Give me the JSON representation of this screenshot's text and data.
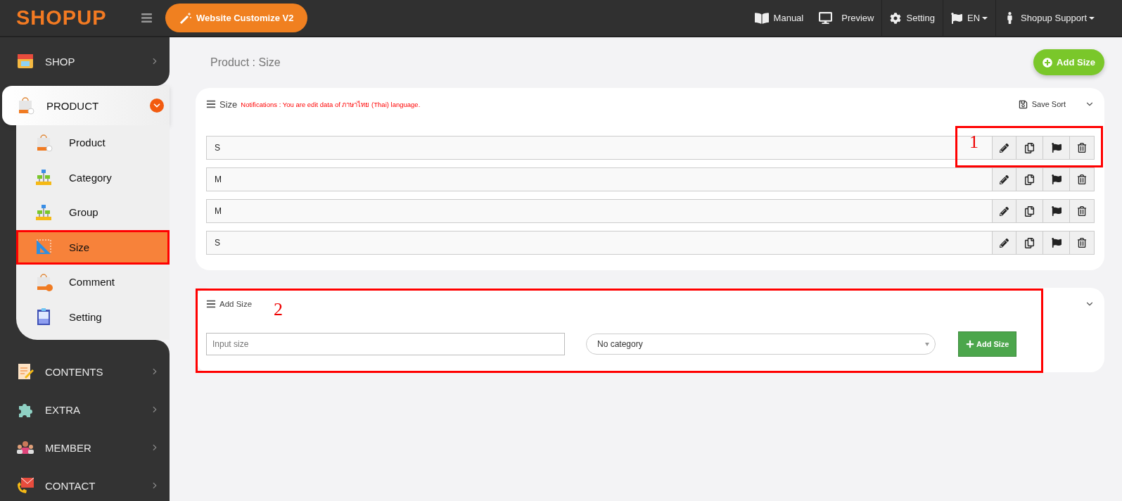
{
  "brand": {
    "logo": "SHOPUP"
  },
  "topbar": {
    "customize_button": "Website Customize V2",
    "links": [
      {
        "kind": "manual",
        "label": "Manual",
        "dropdown": false
      },
      {
        "kind": "preview",
        "label": "Preview",
        "dropdown": false
      },
      {
        "kind": "setting",
        "label": "Setting",
        "dropdown": false
      },
      {
        "kind": "language",
        "label": "EN",
        "dropdown": true
      },
      {
        "kind": "user",
        "label": "Shopup Support",
        "dropdown": true
      }
    ]
  },
  "sidebar": {
    "items": [
      {
        "kind": "shop",
        "label": "SHOP",
        "expanded": false
      },
      {
        "kind": "product",
        "label": "PRODUCT",
        "expanded": true,
        "children": [
          {
            "kind": "product",
            "label": "Product",
            "selected": false,
            "annotated": false
          },
          {
            "kind": "category",
            "label": "Category",
            "selected": false,
            "annotated": false
          },
          {
            "kind": "group",
            "label": "Group",
            "selected": false,
            "annotated": false
          },
          {
            "kind": "size",
            "label": "Size",
            "selected": true,
            "annotated": true
          },
          {
            "kind": "comment",
            "label": "Comment",
            "selected": false,
            "annotated": false
          },
          {
            "kind": "setting",
            "label": "Setting",
            "selected": false,
            "annotated": false
          }
        ]
      },
      {
        "kind": "contents",
        "label": "CONTENTS",
        "expanded": false
      },
      {
        "kind": "extra",
        "label": "EXTRA",
        "expanded": false
      },
      {
        "kind": "member",
        "label": "MEMBER",
        "expanded": false
      },
      {
        "kind": "contact",
        "label": "CONTACT",
        "expanded": false
      }
    ]
  },
  "page": {
    "title": "Product : Size",
    "add_button": "Add Size"
  },
  "size_list": {
    "title": "Size",
    "notice": "Notifications : You are edit data of ภาษาไทย (Thai) language.",
    "save_sort": "Save Sort",
    "rows": [
      {
        "value": "S",
        "annotation": "1"
      },
      {
        "value": "M"
      },
      {
        "value": "M"
      },
      {
        "value": "S"
      }
    ]
  },
  "add_form": {
    "title": "Add Size",
    "annotation": "2",
    "input": {
      "placeholder": "Input size"
    },
    "select": {
      "value": "No category"
    },
    "button": "Add Size"
  }
}
